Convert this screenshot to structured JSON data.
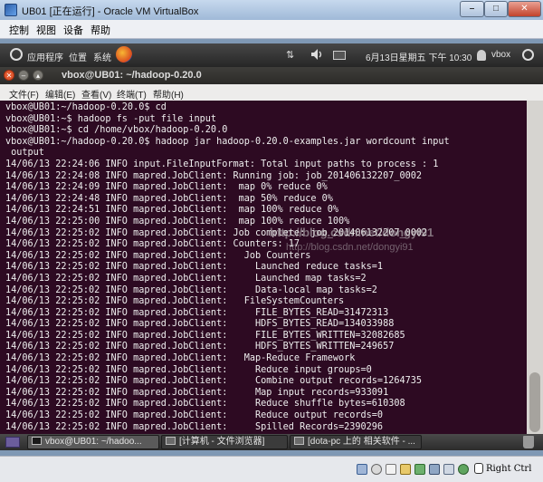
{
  "host_window": {
    "title": "UB01 [正在运行] - Oracle VM VirtualBox",
    "menu": [
      "控制",
      "视图",
      "设备",
      "帮助"
    ]
  },
  "guest_panel": {
    "applications": "应用程序",
    "places": "位置",
    "system": "系统",
    "datetime": "6月13日星期五 下午 10:30",
    "user": "vbox"
  },
  "terminal": {
    "title": "vbox@UB01: ~/hadoop-0.20.0",
    "menu": [
      "文件(F)",
      "编辑(E)",
      "查看(V)",
      "终端(T)",
      "帮助(H)"
    ],
    "lines": [
      "vbox@UB01:~/hadoop-0.20.0$ cd",
      "vbox@UB01:~$ hadoop fs -put file input",
      "vbox@UB01:~$ cd /home/vbox/hadoop-0.20.0",
      "vbox@UB01:~/hadoop-0.20.0$ hadoop jar hadoop-0.20.0-examples.jar wordcount input",
      " output",
      "14/06/13 22:24:06 INFO input.FileInputFormat: Total input paths to process : 1",
      "14/06/13 22:24:08 INFO mapred.JobClient: Running job: job_201406132207_0002",
      "14/06/13 22:24:09 INFO mapred.JobClient:  map 0% reduce 0%",
      "14/06/13 22:24:48 INFO mapred.JobClient:  map 50% reduce 0%",
      "14/06/13 22:24:51 INFO mapred.JobClient:  map 100% reduce 0%",
      "14/06/13 22:25:00 INFO mapred.JobClient:  map 100% reduce 100%",
      "14/06/13 22:25:02 INFO mapred.JobClient: Job complete: job_201406132207_0002",
      "14/06/13 22:25:02 INFO mapred.JobClient: Counters: 17",
      "14/06/13 22:25:02 INFO mapred.JobClient:   Job Counters",
      "14/06/13 22:25:02 INFO mapred.JobClient:     Launched reduce tasks=1",
      "14/06/13 22:25:02 INFO mapred.JobClient:     Launched map tasks=2",
      "14/06/13 22:25:02 INFO mapred.JobClient:     Data-local map tasks=2",
      "14/06/13 22:25:02 INFO mapred.JobClient:   FileSystemCounters",
      "14/06/13 22:25:02 INFO mapred.JobClient:     FILE_BYTES_READ=31472313",
      "14/06/13 22:25:02 INFO mapred.JobClient:     HDFS_BYTES_READ=134033988",
      "14/06/13 22:25:02 INFO mapred.JobClient:     FILE_BYTES_WRITTEN=32082685",
      "14/06/13 22:25:02 INFO mapred.JobClient:     HDFS_BYTES_WRITTEN=249657",
      "14/06/13 22:25:02 INFO mapred.JobClient:   Map-Reduce Framework",
      "14/06/13 22:25:02 INFO mapred.JobClient:     Reduce input groups=0",
      "14/06/13 22:25:02 INFO mapred.JobClient:     Combine output records=1264735",
      "14/06/13 22:25:02 INFO mapred.JobClient:     Map input records=933091",
      "14/06/13 22:25:02 INFO mapred.JobClient:     Reduce shuffle bytes=610308",
      "14/06/13 22:25:02 INFO mapred.JobClient:     Reduce output records=0",
      "14/06/13 22:25:02 INFO mapred.JobClient:     Spilled Records=2390296"
    ],
    "watermark": "http://blog.csdn.net/dongyi91",
    "watermark_sub": "http://blog.csdn.net/dongyi91"
  },
  "taskbar": {
    "tasks": [
      "vbox@UB01: ~/hadoo...",
      "[计算机 - 文件浏览器]",
      "[dota-pc 上的 相关软件 - ..."
    ]
  },
  "statusbar": {
    "host_key": "Right Ctrl"
  }
}
